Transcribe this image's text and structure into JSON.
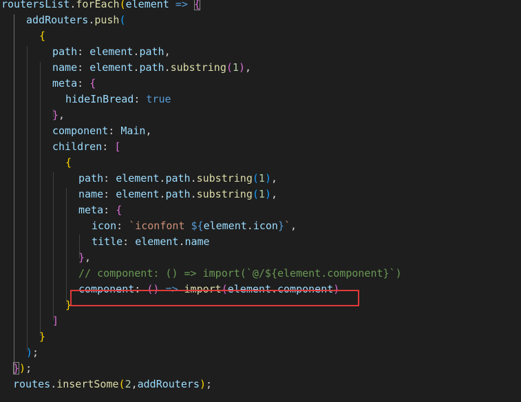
{
  "colors": {
    "background": "#1e1e1e",
    "default": "#d4d4d4",
    "variable": "#9cdcfe",
    "function": "#dcdcaa",
    "keyword": "#569cd6",
    "string": "#ce9178",
    "number": "#b5cea8",
    "comment": "#6a9955",
    "bracket_gold": "#ffd700",
    "bracket_pink": "#da70d6",
    "bracket_blue": "#179fff",
    "highlight_box": "#e03a3a"
  },
  "code_lines": [
    {
      "indent": 2,
      "tokens": [
        {
          "t": "routersList",
          "c": "variable"
        },
        {
          "t": ".",
          "c": "default"
        },
        {
          "t": "forEach",
          "c": "function"
        },
        {
          "t": "(",
          "c": "bracket_gold"
        },
        {
          "t": "element",
          "c": "variable"
        },
        {
          "t": " ",
          "c": "default"
        },
        {
          "t": "=>",
          "c": "keyword"
        },
        {
          "t": " ",
          "c": "default"
        },
        {
          "t": "{",
          "c": "bracket_pink",
          "cursor": true
        }
      ]
    },
    {
      "indent": 38,
      "tokens": [
        {
          "t": "addRouters",
          "c": "variable"
        },
        {
          "t": ".",
          "c": "default"
        },
        {
          "t": "push",
          "c": "function"
        },
        {
          "t": "(",
          "c": "bracket_blue"
        }
      ]
    },
    {
      "indent": 57,
      "tokens": [
        {
          "t": "{",
          "c": "bracket_gold"
        }
      ]
    },
    {
      "indent": 76,
      "tokens": [
        {
          "t": "path",
          "c": "variable"
        },
        {
          "t": ": ",
          "c": "default"
        },
        {
          "t": "element",
          "c": "variable"
        },
        {
          "t": ".",
          "c": "default"
        },
        {
          "t": "path",
          "c": "variable"
        },
        {
          "t": ",",
          "c": "default"
        }
      ]
    },
    {
      "indent": 76,
      "tokens": [
        {
          "t": "name",
          "c": "variable"
        },
        {
          "t": ": ",
          "c": "default"
        },
        {
          "t": "element",
          "c": "variable"
        },
        {
          "t": ".",
          "c": "default"
        },
        {
          "t": "path",
          "c": "variable"
        },
        {
          "t": ".",
          "c": "default"
        },
        {
          "t": "substring",
          "c": "function"
        },
        {
          "t": "(",
          "c": "bracket_pink"
        },
        {
          "t": "1",
          "c": "number"
        },
        {
          "t": ")",
          "c": "bracket_pink"
        },
        {
          "t": ",",
          "c": "default"
        }
      ]
    },
    {
      "indent": 76,
      "tokens": [
        {
          "t": "meta",
          "c": "variable"
        },
        {
          "t": ": ",
          "c": "default"
        },
        {
          "t": "{",
          "c": "bracket_pink"
        }
      ]
    },
    {
      "indent": 95,
      "tokens": [
        {
          "t": "hideInBread",
          "c": "variable"
        },
        {
          "t": ": ",
          "c": "default"
        },
        {
          "t": "true",
          "c": "keyword"
        }
      ]
    },
    {
      "indent": 76,
      "tokens": [
        {
          "t": "}",
          "c": "bracket_pink"
        },
        {
          "t": ",",
          "c": "default"
        }
      ]
    },
    {
      "indent": 76,
      "tokens": [
        {
          "t": "component",
          "c": "variable"
        },
        {
          "t": ": ",
          "c": "default"
        },
        {
          "t": "Main",
          "c": "variable"
        },
        {
          "t": ",",
          "c": "default"
        }
      ]
    },
    {
      "indent": 76,
      "tokens": [
        {
          "t": "children",
          "c": "variable"
        },
        {
          "t": ": ",
          "c": "default"
        },
        {
          "t": "[",
          "c": "bracket_pink"
        }
      ]
    },
    {
      "indent": 95,
      "tokens": [
        {
          "t": "{",
          "c": "bracket_gold"
        }
      ]
    },
    {
      "indent": 114,
      "tokens": [
        {
          "t": "path",
          "c": "variable"
        },
        {
          "t": ": ",
          "c": "default"
        },
        {
          "t": "element",
          "c": "variable"
        },
        {
          "t": ".",
          "c": "default"
        },
        {
          "t": "path",
          "c": "variable"
        },
        {
          "t": ".",
          "c": "default"
        },
        {
          "t": "substring",
          "c": "function"
        },
        {
          "t": "(",
          "c": "bracket_blue"
        },
        {
          "t": "1",
          "c": "number"
        },
        {
          "t": ")",
          "c": "bracket_blue"
        },
        {
          "t": ",",
          "c": "default"
        }
      ]
    },
    {
      "indent": 114,
      "tokens": [
        {
          "t": "name",
          "c": "variable"
        },
        {
          "t": ": ",
          "c": "default"
        },
        {
          "t": "element",
          "c": "variable"
        },
        {
          "t": ".",
          "c": "default"
        },
        {
          "t": "path",
          "c": "variable"
        },
        {
          "t": ".",
          "c": "default"
        },
        {
          "t": "substring",
          "c": "function"
        },
        {
          "t": "(",
          "c": "bracket_blue"
        },
        {
          "t": "1",
          "c": "number"
        },
        {
          "t": ")",
          "c": "bracket_blue"
        },
        {
          "t": ",",
          "c": "default"
        }
      ]
    },
    {
      "indent": 114,
      "tokens": [
        {
          "t": "meta",
          "c": "variable"
        },
        {
          "t": ": ",
          "c": "default"
        },
        {
          "t": "{",
          "c": "bracket_pink"
        }
      ]
    },
    {
      "indent": 133,
      "tokens": [
        {
          "t": "icon",
          "c": "variable"
        },
        {
          "t": ": ",
          "c": "default"
        },
        {
          "t": "`iconfont ",
          "c": "string"
        },
        {
          "t": "${",
          "c": "keyword"
        },
        {
          "t": "element",
          "c": "variable"
        },
        {
          "t": ".",
          "c": "default"
        },
        {
          "t": "icon",
          "c": "variable"
        },
        {
          "t": "}",
          "c": "keyword"
        },
        {
          "t": "`",
          "c": "string"
        },
        {
          "t": ",",
          "c": "default"
        }
      ]
    },
    {
      "indent": 133,
      "tokens": [
        {
          "t": "title",
          "c": "variable"
        },
        {
          "t": ": ",
          "c": "default"
        },
        {
          "t": "element",
          "c": "variable"
        },
        {
          "t": ".",
          "c": "default"
        },
        {
          "t": "name",
          "c": "variable"
        }
      ]
    },
    {
      "indent": 114,
      "tokens": [
        {
          "t": "}",
          "c": "bracket_pink"
        },
        {
          "t": ",",
          "c": "default"
        }
      ]
    },
    {
      "indent": 114,
      "tokens": [
        {
          "t": "// component: () => import(`@/${element.component}`)",
          "c": "comment"
        }
      ]
    },
    {
      "indent": 114,
      "highlighted": true,
      "tokens": [
        {
          "t": "component",
          "c": "variable"
        },
        {
          "t": ": ",
          "c": "default"
        },
        {
          "t": "(",
          "c": "bracket_pink"
        },
        {
          "t": ")",
          "c": "bracket_pink"
        },
        {
          "t": " ",
          "c": "default"
        },
        {
          "t": "=>",
          "c": "keyword"
        },
        {
          "t": " ",
          "c": "default"
        },
        {
          "t": "import",
          "c": "function"
        },
        {
          "t": "(",
          "c": "bracket_pink"
        },
        {
          "t": "element",
          "c": "variable"
        },
        {
          "t": ".",
          "c": "default"
        },
        {
          "t": "component",
          "c": "variable"
        },
        {
          "t": ")",
          "c": "bracket_pink"
        }
      ]
    },
    {
      "indent": 95,
      "tokens": [
        {
          "t": "}",
          "c": "bracket_gold"
        }
      ]
    },
    {
      "indent": 76,
      "tokens": [
        {
          "t": "]",
          "c": "bracket_pink"
        }
      ]
    },
    {
      "indent": 57,
      "tokens": [
        {
          "t": "}",
          "c": "bracket_gold"
        }
      ]
    },
    {
      "indent": 38,
      "tokens": [
        {
          "t": ")",
          "c": "bracket_blue"
        },
        {
          "t": ";",
          "c": "default"
        }
      ]
    },
    {
      "indent": 19,
      "tokens": [
        {
          "t": "}",
          "c": "bracket_pink",
          "cursor": true
        },
        {
          "t": ")",
          "c": "bracket_gold"
        },
        {
          "t": ";",
          "c": "default"
        }
      ]
    },
    {
      "indent": 19,
      "tokens": [
        {
          "t": "routes",
          "c": "variable"
        },
        {
          "t": ".",
          "c": "default"
        },
        {
          "t": "insertSome",
          "c": "function"
        },
        {
          "t": "(",
          "c": "bracket_gold"
        },
        {
          "t": "2",
          "c": "number"
        },
        {
          "t": ",",
          "c": "default"
        },
        {
          "t": "addRouters",
          "c": "variable"
        },
        {
          "t": ")",
          "c": "bracket_gold"
        },
        {
          "t": ";",
          "c": "default"
        }
      ]
    }
  ]
}
